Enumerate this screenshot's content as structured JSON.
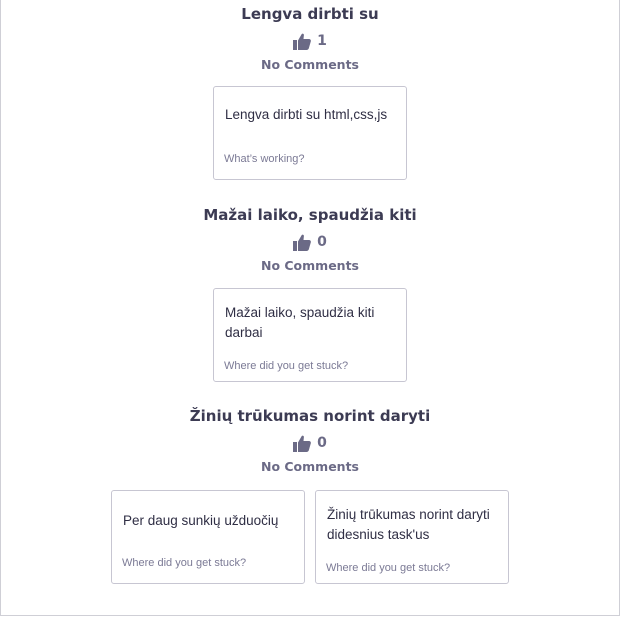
{
  "groups": [
    {
      "title": "Lengva dirbti su",
      "votes": "1",
      "comments_label": "No Comments",
      "cards": [
        {
          "text": "Lengva dirbti su html,css,js",
          "prompt": "What’s working?"
        }
      ]
    },
    {
      "title": "Mažai laiko, spaudžia kiti",
      "votes": "0",
      "comments_label": "No Comments",
      "cards": [
        {
          "text": "Mažai laiko, spaudžia kiti darbai",
          "prompt": "Where did you get stuck?"
        }
      ]
    },
    {
      "title": "Žinių trūkumas norint daryti",
      "votes": "0",
      "comments_label": "No Comments",
      "cards": [
        {
          "text": "Per daug sunkių užduočių",
          "prompt": "Where did you get stuck?"
        },
        {
          "text": "Žinių trūkumas norint daryti didesnius task'us",
          "prompt": "Where did you get stuck?"
        }
      ]
    }
  ],
  "icons": {
    "vote": "thumbs-up-icon"
  },
  "colors": {
    "title": "#3c3b53",
    "muted": "#6b6a86",
    "card_border": "#c7c6d2"
  }
}
